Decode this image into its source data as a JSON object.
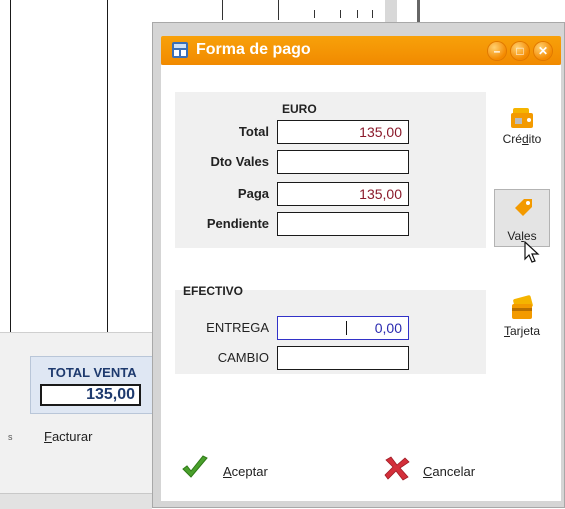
{
  "background": {
    "total_venta_label": "TOTAL VENTA",
    "total_venta_value": "135,00",
    "facturar_prefix": "F",
    "facturar_rest": "acturar",
    "side_mark": "s"
  },
  "dialog": {
    "title": "Forma de pago",
    "euro": {
      "header": "EURO",
      "total_label": "Total",
      "total_value": "135,00",
      "dto_vales_label": "Dto Vales",
      "dto_vales_value": "",
      "paga_label": "Paga",
      "paga_value": "135,00",
      "pendiente_label": "Pendiente",
      "pendiente_value": ""
    },
    "efectivo": {
      "header": "EFECTIVO",
      "entrega_label": "ENTREGA",
      "entrega_value": "0,00",
      "cambio_label": "CAMBIO",
      "cambio_value": ""
    },
    "side_buttons": {
      "credito_a": "Cré",
      "credito_k": "d",
      "credito_b": "ito",
      "vales_a": "Va",
      "vales_k": "l",
      "vales_b": "es",
      "tarjeta_k": "T",
      "tarjeta_b": "arjeta"
    },
    "actions": {
      "aceptar_k": "A",
      "aceptar_b": "ceptar",
      "cancelar_k": "C",
      "cancelar_b": "ancelar"
    }
  },
  "colors": {
    "titlebar": "#f39200",
    "amount_text": "#8b1a2b",
    "active_field": "#3232c8",
    "total_venta_text": "#1e3a6e"
  }
}
